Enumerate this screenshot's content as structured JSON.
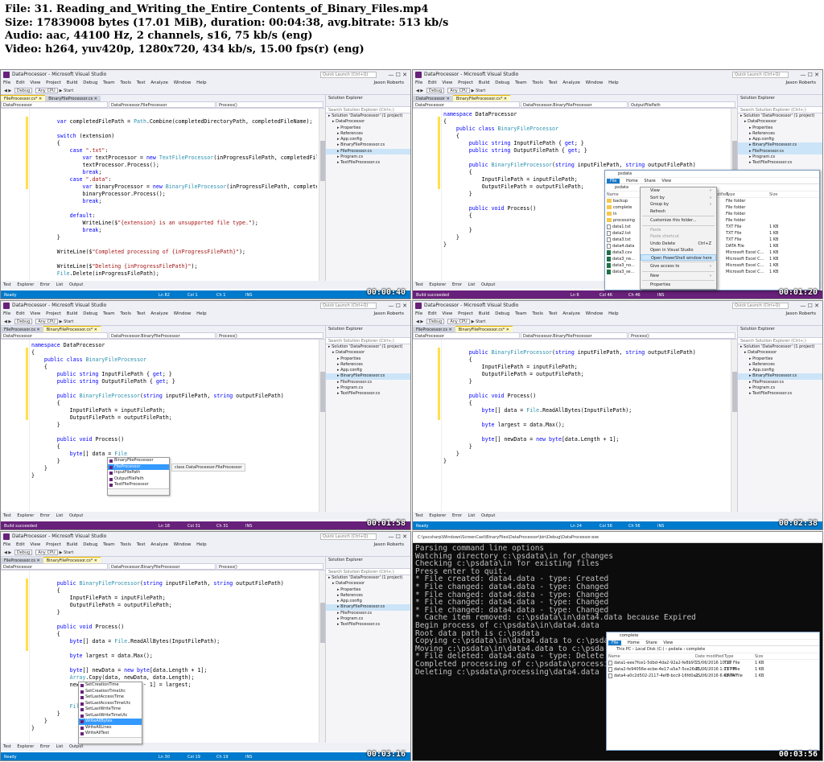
{
  "header": {
    "file": "File: 31. Reading_and_Writing_the_Entire_Contents_of_Binary_Files.mp4",
    "size": "Size: 17839008 bytes (17.01 MiB), duration: 00:04:38, avg.bitrate: 513 kb/s",
    "audio": "Audio: aac, 44100 Hz, 2 channels, s16, 75 kb/s (eng)",
    "video": "Video: h264, yuv420p, 1280x720, 434 kb/s, 15.00 fps(r) (eng)"
  },
  "vs": {
    "window_title": "DataProcessor - Microsoft Visual Studio",
    "quick_launch": "Quick Launch (Ctrl+Q)",
    "menu": "File Edit View Project Build Debug Team Tools Test Analyze Window Help",
    "user": "Jason Roberts",
    "toolbar": {
      "config": "Debug",
      "platform": "Any CPU",
      "start": "▶ Start"
    },
    "bottom_tabs": "Test Explorer Error List Output",
    "se_title": "Solution Explorer",
    "se_search": "Search Solution Explorer (Ctrl+;)",
    "tree": [
      "Solution 'DataProcessor' (1 project)",
      "DataProcessor",
      "Properties",
      "References",
      "App.config",
      "BinaryFileProcessor.cs",
      "FileProcessor.cs",
      "Program.cs",
      "TextFileProcessor.cs"
    ]
  },
  "frames": [
    {
      "tabs": [
        {
          "label": "FileProcessor.cs*",
          "active": true
        },
        {
          "label": "BinaryFileProcessor.cs",
          "active": false
        }
      ],
      "nav": [
        "DataProcessor",
        "DataProcessor.FileProcessor",
        "Process()"
      ],
      "code": [
        "",
        "        var completedFilePath = Path.Combine(completedDirectoryPath, completedFileName);",
        "",
        "        switch (extension)",
        "        {",
        "            case \".txt\":",
        "                var textProcessor = new TextFileProcessor(inProgressFilePath, completedFile",
        "                textProcessor.Process();",
        "                break;",
        "            case \".data\":",
        "                var binaryProcessor = new BinaryFileProcessor(inProgressFilePath, completed",
        "                binaryProcessor.Process();",
        "                break;",
        "",
        "            default:",
        "                WriteLine($\"{extension} is an unsupported file type.\");",
        "                break;",
        "        }",
        "",
        "        WriteLine($\"Completed processing of {inProgressFilePath}\");",
        "",
        "        WriteLine($\"Deleting {inProgressFilePath}\");",
        "        File.Delete(inProgressFilePath);"
      ],
      "status": "Ready",
      "pos": {
        "ln": "Ln 82",
        "col": "Col 1",
        "ch": "Ch 1",
        "ins": "INS"
      },
      "timestamp": "00:00:40"
    },
    {
      "tabs": [
        {
          "label": "DataProcessor",
          "active": false
        },
        {
          "label": "BinaryFileProcessor.cs*",
          "active": true
        }
      ],
      "nav": [
        "DataProcessor",
        "DataProcessor.BinaryFileProcessor",
        "OutputFilePath"
      ],
      "code": [
        "namespace DataProcessor",
        "{",
        "    public class BinaryFileProcessor",
        "    {",
        "        public string InputFilePath { get; }",
        "        public string OutputFilePath { get; }",
        "",
        "        public BinaryFileProcessor(string inputFilePath, string outputFilePath)",
        "        {",
        "            InputFilePath = inputFilePath;",
        "            OutputFilePath = outputFilePath;",
        "        }",
        "",
        "        public void Process()",
        "        {",
        "",
        "        }",
        "    }",
        "}"
      ],
      "status": "Build succeeded",
      "pos": {
        "ln": "Ln 6",
        "col": "Col 46",
        "ch": "Ch 46",
        "ins": "INS"
      },
      "timestamp": "00:01:20",
      "explorer": {
        "title": "psdata",
        "ribbon": [
          "File",
          "Home",
          "Share",
          "View"
        ],
        "addr": "psdata",
        "search": "Search ps...",
        "cols": [
          "Name",
          "Date modified",
          "Type",
          "Size"
        ],
        "rows": [
          {
            "name": "backup",
            "type": "File folder",
            "size": "",
            "kind": "folder",
            "dm": "PM"
          },
          {
            "name": "complete",
            "type": "File folder",
            "size": "",
            "kind": "folder",
            "dm": "PM"
          },
          {
            "name": "in",
            "type": "File folder",
            "size": "",
            "kind": "folder",
            "dm": "PM"
          },
          {
            "name": "processing",
            "type": "File folder",
            "size": "",
            "kind": "folder",
            "dm": "PM"
          },
          {
            "name": "data1.txt",
            "type": "TXT File",
            "size": "1 KB",
            "kind": "file",
            "dm": "PM"
          },
          {
            "name": "data2.txt",
            "type": "TXT File",
            "size": "1 KB",
            "kind": "file",
            "dm": "PM"
          },
          {
            "name": "data3.txt",
            "type": "TXT File",
            "size": "1 KB",
            "kind": "file",
            "dm": "PM"
          },
          {
            "name": "data4.data",
            "type": "DATA File",
            "size": "1 KB",
            "kind": "file",
            "dm": "PM"
          },
          {
            "name": "data3.csv",
            "type": "Microsoft Excel C...",
            "size": "1 KB",
            "kind": "xls",
            "dm": "PM"
          },
          {
            "name": "data3_ne...",
            "type": "Microsoft Excel C...",
            "size": "1 KB",
            "kind": "xls",
            "dm": "PM"
          },
          {
            "name": "data3_no...",
            "type": "Microsoft Excel C...",
            "size": "1 KB",
            "kind": "xls",
            "dm": "PM"
          },
          {
            "name": "data3_se...",
            "type": "Microsoft Excel C...",
            "size": "1 KB",
            "kind": "xls",
            "dm": "PM"
          }
        ]
      },
      "context_menu": [
        {
          "label": "View",
          "arrow": true
        },
        {
          "label": "Sort by",
          "arrow": true
        },
        {
          "label": "Group by",
          "arrow": true
        },
        {
          "label": "Refresh"
        },
        {
          "sep": true
        },
        {
          "label": "Customize this folder..."
        },
        {
          "sep": true
        },
        {
          "label": "Paste",
          "dis": true
        },
        {
          "label": "Paste shortcut",
          "dis": true
        },
        {
          "label": "Undo Delete",
          "shortcut": "Ctrl+Z"
        },
        {
          "label": "Open in Visual Studio"
        },
        {
          "label": "Open PowerShell window here",
          "hl": true
        },
        {
          "sep": true
        },
        {
          "label": "Give access to",
          "arrow": true
        },
        {
          "sep": true
        },
        {
          "label": "New",
          "arrow": true
        },
        {
          "sep": true
        },
        {
          "label": "Properties"
        }
      ]
    },
    {
      "tabs": [
        {
          "label": "FileProcessor.cs",
          "active": false
        },
        {
          "label": "BinaryFileProcessor.cs*",
          "active": true
        }
      ],
      "nav": [
        "DataProcessor",
        "DataProcessor.BinaryFileProcessor",
        "Process()"
      ],
      "code": [
        "namespace DataProcessor",
        "{",
        "    public class BinaryFileProcessor",
        "    {",
        "        public string InputFilePath { get; }",
        "        public string OutputFilePath { get; }",
        "",
        "        public BinaryFileProcessor(string inputFilePath, string outputFilePath)",
        "        {",
        "            InputFilePath = inputFilePath;",
        "            OutputFilePath = outputFilePath;",
        "        }",
        "",
        "        public void Process()",
        "        {",
        "            byte[] data = File",
        "        }",
        "    }",
        "}"
      ],
      "status": "Build succeeded",
      "pos": {
        "ln": "Ln 18",
        "col": "Col 31",
        "ch": "Ch 31",
        "ins": "INS"
      },
      "timestamp": "00:01:58",
      "autocomplete": [
        "BinaryFileProcessor",
        "FileProcessor",
        "InputFilePath",
        "OutputFilePath",
        "TextFileProcessor"
      ],
      "ac_selected": 1,
      "tip": "class DataProcessor.FileProcessor"
    },
    {
      "tabs": [
        {
          "label": "FileProcessor.cs",
          "active": false
        },
        {
          "label": "BinaryFileProcessor.cs*",
          "active": true
        }
      ],
      "nav": [
        "DataProcessor",
        "DataProcessor.BinaryFileProcessor",
        "Process()"
      ],
      "code": [
        "",
        "        public BinaryFileProcessor(string inputFilePath, string outputFilePath)",
        "        {",
        "            InputFilePath = inputFilePath;",
        "            OutputFilePath = outputFilePath;",
        "        }",
        "",
        "        public void Process()",
        "        {",
        "            byte[] data = File.ReadAllBytes(InputFilePath);",
        "",
        "            byte largest = data.Max();",
        "",
        "            byte[] newData = new byte[data.Length + 1];",
        "        }",
        "    }",
        "}"
      ],
      "status": "Ready",
      "pos": {
        "ln": "Ln 24",
        "col": "Col 56",
        "ch": "Ch 56",
        "ins": "INS"
      },
      "timestamp": "00:02:38"
    },
    {
      "tabs": [
        {
          "label": "FileProcessor.cs",
          "active": false
        },
        {
          "label": "BinaryFileProcessor.cs*",
          "active": true
        }
      ],
      "nav": [
        "DataProcessor",
        "DataProcessor.BinaryFileProcessor",
        "Process()"
      ],
      "code": [
        "",
        "        public BinaryFileProcessor(string inputFilePath, string outputFilePath)",
        "        {",
        "            InputFilePath = inputFilePath;",
        "            OutputFilePath = outputFilePath;",
        "        }",
        "",
        "        public void Process()",
        "        {",
        "            byte[] data = File.ReadAllBytes(InputFilePath);",
        "",
        "            byte largest = data.Max();",
        "",
        "            byte[] newData = new byte[data.Length + 1];",
        "            Array.Copy(data, newData, data.Length);",
        "            newData[newData.Length - 1] = largest;",
        "",
        "",
        "            File.W",
        "        }",
        "    }",
        "}"
      ],
      "status": "Ready",
      "pos": {
        "ln": "Ln 30",
        "col": "Col 19",
        "ch": "Ch 19",
        "ins": "INS"
      },
      "timestamp": "00:03:16",
      "autocomplete": [
        "SetCreationTime",
        "SetCreationTimeUtc",
        "SetLastAccessTime",
        "SetLastAccessTimeUtc",
        "SetLastWriteTime",
        "SetLastWriteTimeUtc",
        "WriteAllBytes",
        "WriteAllLines",
        "WriteAllText"
      ],
      "ac_selected": 6
    },
    {
      "console_title": "C:\\pscsharp\\Windows\\ScreenCast\\BinaryFiles\\DataProcessor\\bin\\Debug\\DataProcessor.exe",
      "console": [
        "Parsing command line options",
        "Watching directory c:\\psdata\\in for changes",
        "Checking c:\\psdata\\in for existing files",
        "Press enter to quit.",
        "* File created: data4.data - type: Created",
        "* File changed: data4.data - type: Changed",
        "* File changed: data4.data - type: Changed",
        "* File changed: data4.data - type: Changed",
        "* File changed: data4.data - type: Changed",
        "* Cache item removed: c:\\psdata\\in\\data4.data because Expired",
        "Begin process of c:\\psdata\\in\\data4.data",
        "Root data path is c:\\psdata",
        "Copying c:\\psdata\\in\\data4.data to c:\\psda",
        "Moving c:\\psdata\\in\\data4.data to c:\\psda",
        "* File deleted: data4.data - type: Delete",
        "Completed processing of c:\\psdata\\processi",
        "Deleting c:\\psdata\\processing\\data4.data"
      ],
      "timestamp": "00:03:56",
      "explorer": {
        "title": "complete",
        "ribbon": [
          "File",
          "Home",
          "Share",
          "View"
        ],
        "addr": "This PC › Local Disk (C:) › psdata › complete",
        "search": "Search co...",
        "cols": [
          "Name",
          "Date modified",
          "Type",
          "Size"
        ],
        "rows": [
          {
            "name": "data1-eee7fce1-5dbd-4da2-92a2-fe8b97...",
            "dm": "25/06/2016 10:19",
            "type": "TXT File",
            "size": "1 KB",
            "kind": "file"
          },
          {
            "name": "data2-fe94056e-ecbe-4e17-a5a7-5ce26d1...",
            "dm": "25/06/2016 1:13 PM",
            "type": "TXT File",
            "size": "1 KB",
            "kind": "file"
          },
          {
            "name": "data4-a0c2d502-2117-4ef8-bcc9-16fd0a1...",
            "dm": "25/06/2016 6:43 PM",
            "type": "DATA File",
            "size": "1 KB",
            "kind": "file"
          }
        ]
      }
    }
  ]
}
